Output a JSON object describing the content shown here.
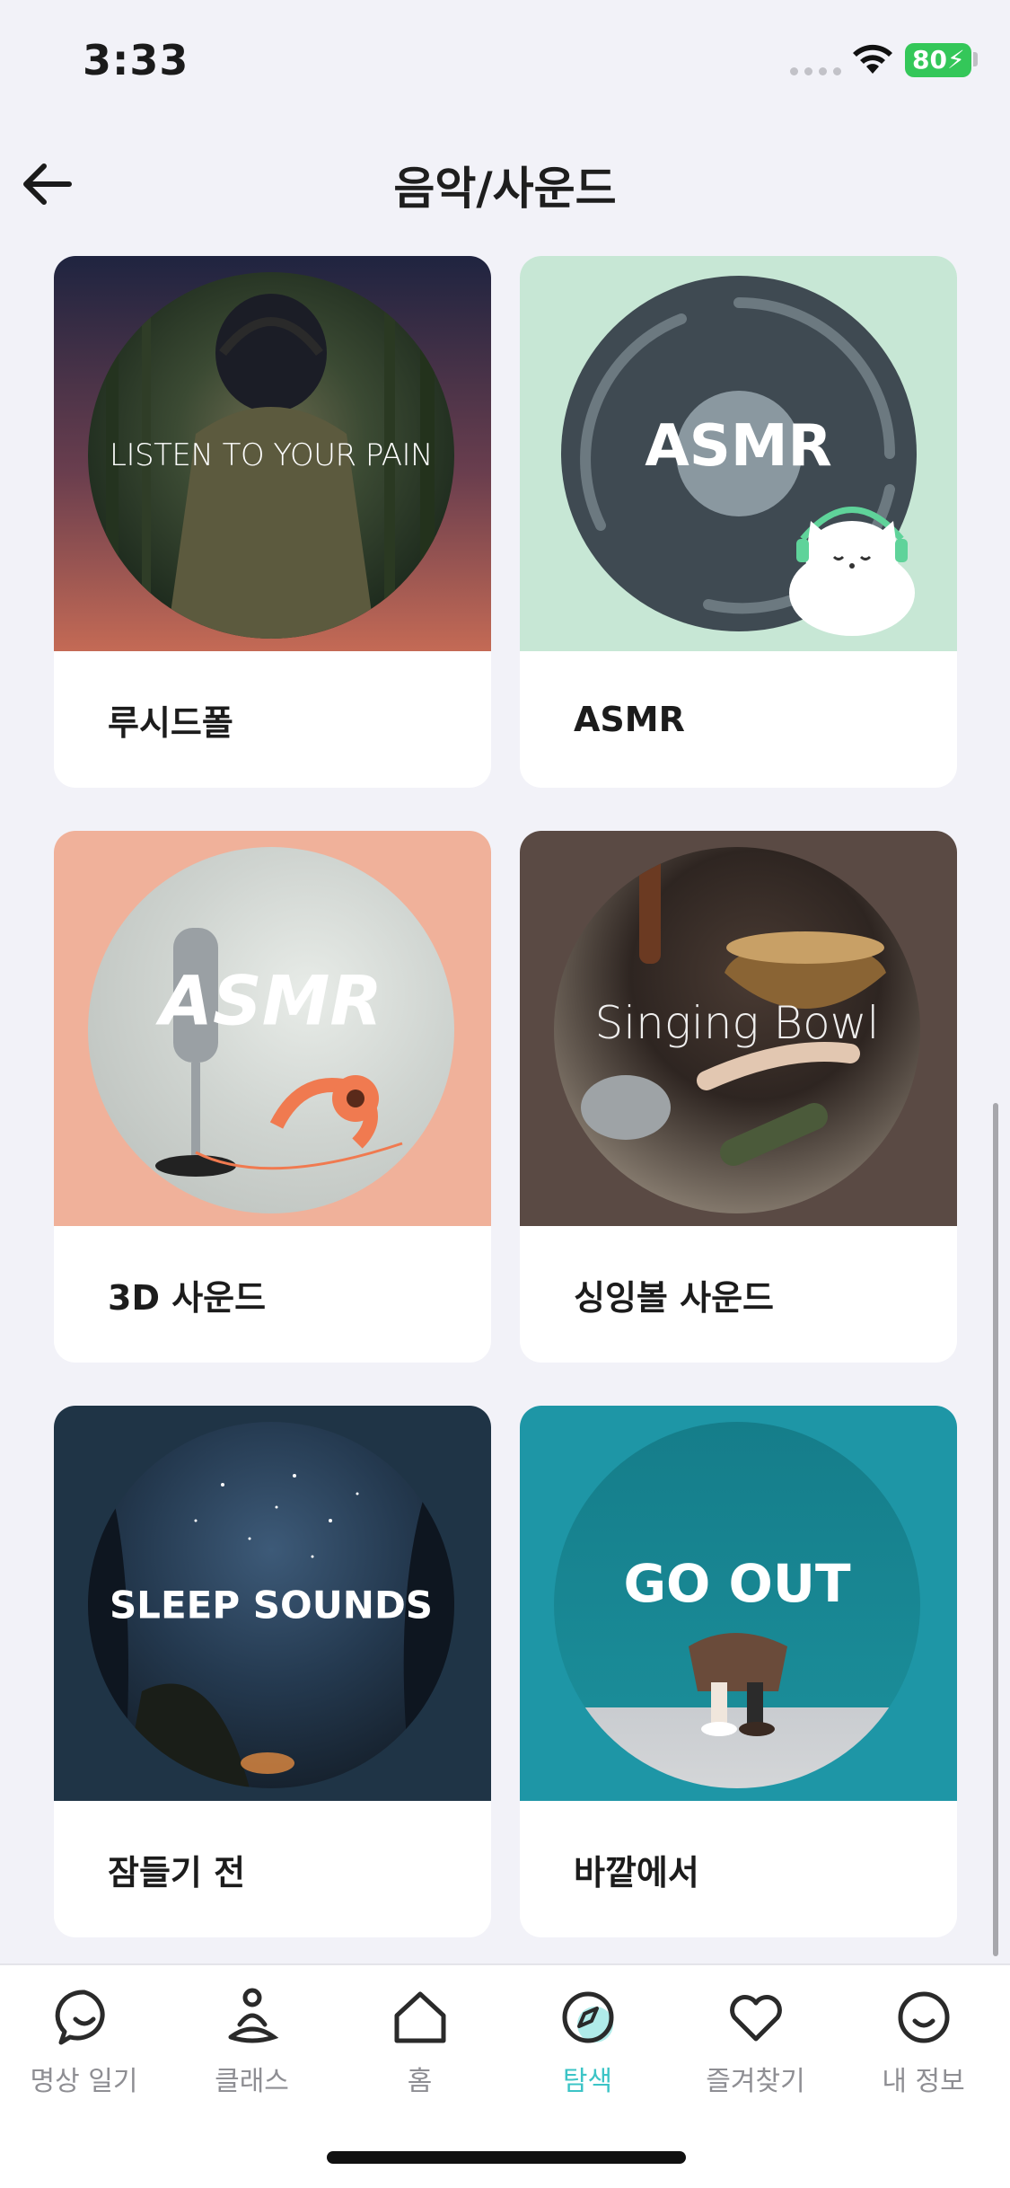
{
  "status_bar": {
    "time": "3:33",
    "battery": "80",
    "battery_color": "#34c759"
  },
  "header": {
    "title": "음악/사운드",
    "back_icon": "arrow-left-icon"
  },
  "cards": [
    {
      "label": "루시드폴",
      "artwork_text": "LISTEN TO YOUR PAIN",
      "bg": "#b8665a"
    },
    {
      "label": "ASMR",
      "artwork_text": "ASMR",
      "bg": "#c7e7d5"
    },
    {
      "label": "3D 사운드",
      "artwork_text": "ASMR",
      "bg": "#f0b19a"
    },
    {
      "label": "싱잉볼 사운드",
      "artwork_text": "Singing Bowl",
      "bg": "#5a4a44"
    },
    {
      "label": "잠들기 전",
      "artwork_text": "SLEEP SOUNDS",
      "bg": "#1f3446"
    },
    {
      "label": "바깥에서",
      "artwork_text": "GO OUT",
      "bg": "#1e96a6"
    }
  ],
  "bottom_nav": {
    "active_color": "#3cc4c6",
    "items": [
      {
        "label": "명상 일기",
        "icon": "chat-smile-icon"
      },
      {
        "label": "클래스",
        "icon": "meditation-person-icon"
      },
      {
        "label": "홈",
        "icon": "home-icon"
      },
      {
        "label": "탐색",
        "icon": "compass-icon",
        "active": true
      },
      {
        "label": "즐겨찾기",
        "icon": "heart-icon"
      },
      {
        "label": "내 정보",
        "icon": "profile-smile-icon"
      }
    ]
  }
}
